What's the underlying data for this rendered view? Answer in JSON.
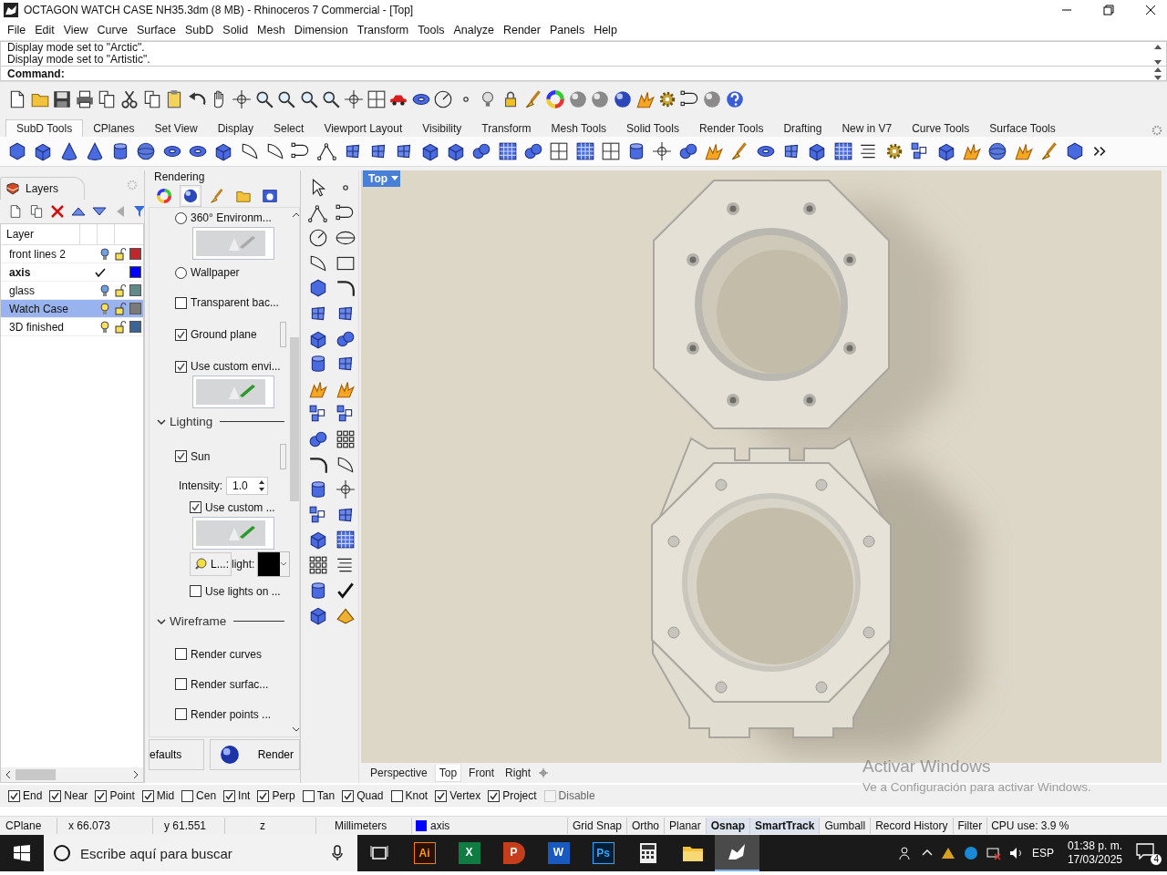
{
  "window": {
    "title": "OCTAGON WATCH CASE NH35.3dm (8 MB) - Rhinoceros 7 Commercial - [Top]"
  },
  "menu": [
    "File",
    "Edit",
    "View",
    "Curve",
    "Surface",
    "SubD",
    "Solid",
    "Mesh",
    "Dimension",
    "Transform",
    "Tools",
    "Analyze",
    "Render",
    "Panels",
    "Help"
  ],
  "command": {
    "history": [
      "Display mode set to \"Arctic\".",
      "Display mode set to \"Artistic\"."
    ],
    "prompt": "Command:"
  },
  "toolbar_tabs": [
    {
      "label": "SubD Tools",
      "selected": true
    },
    {
      "label": "CPlanes",
      "selected": false
    },
    {
      "label": "Set View",
      "selected": false
    },
    {
      "label": "Display",
      "selected": false
    },
    {
      "label": "Select",
      "selected": false
    },
    {
      "label": "Viewport Layout",
      "selected": false
    },
    {
      "label": "Visibility",
      "selected": false
    },
    {
      "label": "Transform",
      "selected": false
    },
    {
      "label": "Mesh Tools",
      "selected": false
    },
    {
      "label": "Solid Tools",
      "selected": false
    },
    {
      "label": "Render Tools",
      "selected": false
    },
    {
      "label": "Drafting",
      "selected": false
    },
    {
      "label": "New in V7",
      "selected": false
    },
    {
      "label": "Curve Tools",
      "selected": false
    },
    {
      "label": "Surface Tools",
      "selected": false
    }
  ],
  "layers": {
    "title": "Layers",
    "column": "Layer",
    "rows": [
      {
        "name": "front lines 2",
        "current": false,
        "lit": false,
        "selected": false,
        "color": "#c0272d"
      },
      {
        "name": "axis",
        "current": true,
        "selected": false,
        "color": "#0000ff"
      },
      {
        "name": "glass",
        "current": false,
        "lit": false,
        "selected": false,
        "color": "#5f8a88"
      },
      {
        "name": "Watch Case",
        "current": false,
        "lit": true,
        "selected": true,
        "color": "#7a7a7a"
      },
      {
        "name": "3D finished",
        "current": false,
        "lit": true,
        "selected": false,
        "color": "#3a6496"
      }
    ]
  },
  "rendering": {
    "title": "Rendering",
    "items": [
      {
        "kind": "radio",
        "label": "360° Environm...",
        "checked": false
      },
      {
        "kind": "preview",
        "enabled": false
      },
      {
        "kind": "radio",
        "label": "Wallpaper",
        "checked": false
      },
      {
        "kind": "checkbox",
        "label": "Transparent bac...",
        "checked": false
      },
      {
        "kind": "checkbox",
        "label": "Ground plane",
        "checked": true,
        "side_button": true
      },
      {
        "kind": "checkbox",
        "label": "Use custom envi...",
        "checked": true
      },
      {
        "kind": "preview",
        "enabled": true
      },
      {
        "kind": "section",
        "label": "Lighting",
        "expanded": true
      },
      {
        "kind": "checkbox",
        "label": "Sun",
        "checked": true,
        "side_button": true,
        "children": [
          {
            "kind": "spinner",
            "label": "Intensity:",
            "value": "1.0"
          },
          {
            "kind": "checkbox",
            "label": "Use custom ...",
            "checked": true
          },
          {
            "kind": "preview",
            "enabled": true
          },
          {
            "kind": "light",
            "button": "L...:",
            "label": "light:",
            "color": "#000000"
          },
          {
            "kind": "checkbox",
            "label": "Use lights on ...",
            "checked": false
          }
        ]
      },
      {
        "kind": "section",
        "label": "Wireframe",
        "expanded": true
      },
      {
        "kind": "checkbox",
        "label": "Render curves",
        "checked": false
      },
      {
        "kind": "checkbox",
        "label": "Render surfac...",
        "checked": false
      },
      {
        "kind": "checkbox",
        "label": "Render points ...",
        "checked": false
      }
    ],
    "buttons": [
      "efaults",
      "Render"
    ]
  },
  "viewport": {
    "label": "Top",
    "tabs": [
      {
        "label": "Perspective",
        "selected": false
      },
      {
        "label": "Top",
        "selected": true
      },
      {
        "label": "Front",
        "selected": false
      },
      {
        "label": "Right",
        "selected": false
      }
    ]
  },
  "activation": {
    "title": "Activar Windows",
    "text": "Ve a Configuración para activar Windows."
  },
  "osnaps": [
    {
      "label": "End",
      "checked": true,
      "disabled": false
    },
    {
      "label": "Near",
      "checked": true,
      "disabled": false
    },
    {
      "label": "Point",
      "checked": true,
      "disabled": false
    },
    {
      "label": "Mid",
      "checked": true,
      "disabled": false
    },
    {
      "label": "Cen",
      "checked": false,
      "disabled": false
    },
    {
      "label": "Int",
      "checked": true,
      "disabled": false
    },
    {
      "label": "Perp",
      "checked": true,
      "disabled": false
    },
    {
      "label": "Tan",
      "checked": false,
      "disabled": false
    },
    {
      "label": "Quad",
      "checked": true,
      "disabled": false
    },
    {
      "label": "Knot",
      "checked": false,
      "disabled": false
    },
    {
      "label": "Vertex",
      "checked": true,
      "disabled": false
    },
    {
      "label": "Project",
      "checked": true,
      "disabled": false
    },
    {
      "label": "Disable",
      "checked": false,
      "disabled": true
    }
  ],
  "status": {
    "cells": [
      "CPlane",
      "x 66.073",
      "y 61.551",
      "z",
      "Millimeters"
    ],
    "layer": {
      "name": "axis",
      "color": "#0000ff"
    },
    "toggles": [
      {
        "label": "Grid Snap",
        "on": false
      },
      {
        "label": "Ortho",
        "on": false
      },
      {
        "label": "Planar",
        "on": false
      },
      {
        "label": "Osnap",
        "on": true
      },
      {
        "label": "SmartTrack",
        "on": true
      },
      {
        "label": "Gumball",
        "on": false
      },
      {
        "label": "Record History",
        "on": false
      },
      {
        "label": "Filter",
        "on": false
      }
    ],
    "cpu": "CPU use: 3.9 %"
  },
  "taskbar": {
    "search": {
      "placeholder": "Escribe aquí para buscar"
    },
    "apps": [
      {
        "kind": "taskview",
        "selected": false
      },
      {
        "kind": "ai",
        "label": "Ai",
        "selected": false
      },
      {
        "kind": "excel",
        "label": "X",
        "selected": false
      },
      {
        "kind": "powerpoint",
        "label": "P",
        "selected": false
      },
      {
        "kind": "word",
        "label": "W",
        "selected": false
      },
      {
        "kind": "ps",
        "label": "Ps",
        "selected": false
      },
      {
        "kind": "calculator",
        "selected": false
      },
      {
        "kind": "folder",
        "selected": false
      },
      {
        "kind": "rhino",
        "selected": true
      }
    ],
    "language": "ESP",
    "time": "01:38 p. m.",
    "date": "17/03/2025",
    "notifications": "4"
  }
}
